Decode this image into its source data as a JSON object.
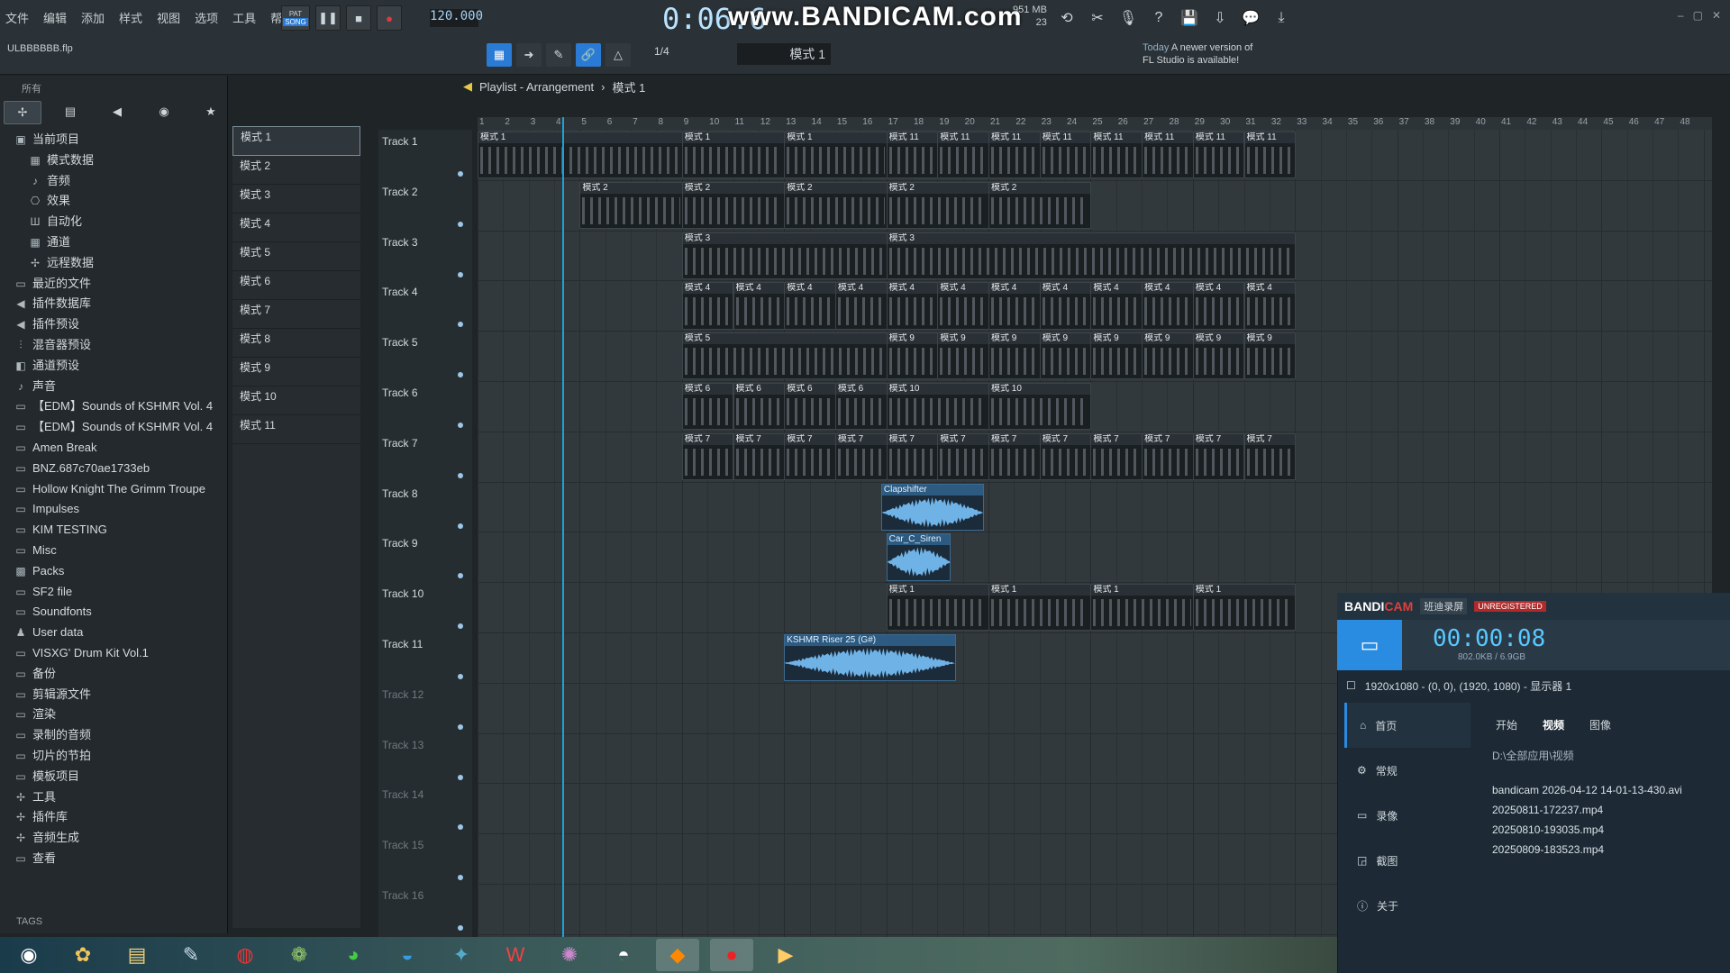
{
  "app": {
    "menus": [
      "文件",
      "编辑",
      "添加",
      "样式",
      "视图",
      "选项",
      "工具",
      "帮助"
    ],
    "tempo": "120.000",
    "time": "0:06:6",
    "time_label": "M:S:CS",
    "watermark": "www.BANDICAM.com",
    "memory": "951 MB",
    "cpu": "23",
    "project": "ULBBBBBB.flp",
    "snap": "1/4",
    "pattern_selector": "模式 1",
    "news_day": "Today",
    "news_text": "A newer version of",
    "news_text2": "FL Studio is available!",
    "mode_pat": "PAT",
    "mode_song": "SONG"
  },
  "browser": {
    "header": "所有",
    "tabs": [
      "all-icon",
      "files-icon",
      "speaker-icon",
      "globe-icon",
      "star-icon"
    ],
    "items": [
      {
        "label": "当前项目",
        "icon": "▣",
        "indent": 0
      },
      {
        "label": "模式数据",
        "icon": "▦",
        "indent": 1
      },
      {
        "label": "音频",
        "icon": "♪",
        "indent": 1
      },
      {
        "label": "效果",
        "icon": "⎔",
        "indent": 1
      },
      {
        "label": "自动化",
        "icon": "Ш",
        "indent": 1
      },
      {
        "label": "通道",
        "icon": "▦",
        "indent": 1
      },
      {
        "label": "远程数据",
        "icon": "✢",
        "indent": 1
      },
      {
        "label": "最近的文件",
        "icon": "▭",
        "indent": 0
      },
      {
        "label": "插件数据库",
        "icon": "◀",
        "indent": 0
      },
      {
        "label": "插件预设",
        "icon": "◀",
        "indent": 0
      },
      {
        "label": "混音器预设",
        "icon": "⫶",
        "indent": 0
      },
      {
        "label": "通道预设",
        "icon": "◧",
        "indent": 0
      },
      {
        "label": "声音",
        "icon": "♪",
        "indent": 0
      },
      {
        "label": "【EDM】Sounds of KSHMR Vol. 4",
        "icon": "▭",
        "indent": 0
      },
      {
        "label": "【EDM】Sounds of KSHMR Vol. 4",
        "icon": "▭",
        "indent": 0
      },
      {
        "label": "Amen Break",
        "icon": "▭",
        "indent": 0
      },
      {
        "label": "BNZ.687c70ae1733eb",
        "icon": "▭",
        "indent": 0
      },
      {
        "label": "Hollow Knight The Grimm Troupe",
        "icon": "▭",
        "indent": 0
      },
      {
        "label": "Impulses",
        "icon": "▭",
        "indent": 0
      },
      {
        "label": "KIM TESTING",
        "icon": "▭",
        "indent": 0
      },
      {
        "label": "Misc",
        "icon": "▭",
        "indent": 0
      },
      {
        "label": "Packs",
        "icon": "▩",
        "indent": 0
      },
      {
        "label": "SF2 file",
        "icon": "▭",
        "indent": 0
      },
      {
        "label": "Soundfonts",
        "icon": "▭",
        "indent": 0
      },
      {
        "label": "User data",
        "icon": "♟",
        "indent": 0
      },
      {
        "label": "VISXG' Drum Kit Vol.1",
        "icon": "▭",
        "indent": 0
      },
      {
        "label": "备份",
        "icon": "▭",
        "indent": 0
      },
      {
        "label": "剪辑源文件",
        "icon": "▭",
        "indent": 0
      },
      {
        "label": "渲染",
        "icon": "▭",
        "indent": 0
      },
      {
        "label": "录制的音频",
        "icon": "▭",
        "indent": 0
      },
      {
        "label": "切片的节拍",
        "icon": "▭",
        "indent": 0
      },
      {
        "label": "模板项目",
        "icon": "▭",
        "indent": 0
      },
      {
        "label": "工具",
        "icon": "✢",
        "indent": 0
      },
      {
        "label": "插件库",
        "icon": "✢",
        "indent": 0
      },
      {
        "label": "音频生成",
        "icon": "✢",
        "indent": 0
      },
      {
        "label": "查看",
        "icon": "▭",
        "indent": 0
      }
    ],
    "tags_label": "TAGS"
  },
  "patterns": [
    "模式 1",
    "模式 2",
    "模式 3",
    "模式 4",
    "模式 5",
    "模式 6",
    "模式 7",
    "模式 8",
    "模式 9",
    "模式 10",
    "模式 11"
  ],
  "playlist": {
    "title": "Playlist - Arrangement",
    "crumb": "模式 1",
    "bars": [
      1,
      2,
      3,
      4,
      5,
      6,
      7,
      8,
      9,
      10,
      11,
      12,
      13,
      14,
      15,
      16,
      17,
      18,
      19,
      20,
      21,
      22,
      23,
      24,
      25,
      26,
      27,
      28,
      29,
      30,
      31,
      32,
      33,
      34,
      35,
      36,
      37,
      38,
      39,
      40,
      41,
      42,
      43,
      44,
      45,
      46,
      47,
      48
    ],
    "tracks": [
      "Track 1",
      "Track 2",
      "Track 3",
      "Track 4",
      "Track 5",
      "Track 6",
      "Track 7",
      "Track 8",
      "Track 9",
      "Track 10",
      "Track 11",
      "Track 12",
      "Track 13",
      "Track 14",
      "Track 15",
      "Track 16"
    ],
    "clips": [
      {
        "track": 0,
        "start": 1,
        "len": 8,
        "label": "模式 1"
      },
      {
        "track": 0,
        "start": 9,
        "len": 4,
        "label": "模式 1"
      },
      {
        "track": 0,
        "start": 13,
        "len": 4,
        "label": "模式 1"
      },
      {
        "track": 0,
        "start": 17,
        "len": 2,
        "label": "模式 11"
      },
      {
        "track": 0,
        "start": 19,
        "len": 2,
        "label": "模式 11"
      },
      {
        "track": 0,
        "start": 21,
        "len": 2,
        "label": "模式 11"
      },
      {
        "track": 0,
        "start": 23,
        "len": 2,
        "label": "模式 11"
      },
      {
        "track": 0,
        "start": 25,
        "len": 2,
        "label": "模式 11"
      },
      {
        "track": 0,
        "start": 27,
        "len": 2,
        "label": "模式 11"
      },
      {
        "track": 0,
        "start": 29,
        "len": 2,
        "label": "模式 11"
      },
      {
        "track": 0,
        "start": 31,
        "len": 2,
        "label": "模式 11"
      },
      {
        "track": 1,
        "start": 5,
        "len": 4,
        "label": "模式 2"
      },
      {
        "track": 1,
        "start": 9,
        "len": 4,
        "label": "模式 2"
      },
      {
        "track": 1,
        "start": 13,
        "len": 4,
        "label": "模式 2"
      },
      {
        "track": 1,
        "start": 17,
        "len": 4,
        "label": "模式 2"
      },
      {
        "track": 1,
        "start": 21,
        "len": 4,
        "label": "模式 2"
      },
      {
        "track": 2,
        "start": 9,
        "len": 8,
        "label": "模式 3"
      },
      {
        "track": 2,
        "start": 17,
        "len": 16,
        "label": "模式 3"
      },
      {
        "track": 3,
        "start": 9,
        "len": 2,
        "label": "模式 4"
      },
      {
        "track": 3,
        "start": 11,
        "len": 2,
        "label": "模式 4"
      },
      {
        "track": 3,
        "start": 13,
        "len": 2,
        "label": "模式 4"
      },
      {
        "track": 3,
        "start": 15,
        "len": 2,
        "label": "模式 4"
      },
      {
        "track": 3,
        "start": 17,
        "len": 2,
        "label": "模式 4"
      },
      {
        "track": 3,
        "start": 19,
        "len": 2,
        "label": "模式 4"
      },
      {
        "track": 3,
        "start": 21,
        "len": 2,
        "label": "模式 4"
      },
      {
        "track": 3,
        "start": 23,
        "len": 2,
        "label": "模式 4"
      },
      {
        "track": 3,
        "start": 25,
        "len": 2,
        "label": "模式 4"
      },
      {
        "track": 3,
        "start": 27,
        "len": 2,
        "label": "模式 4"
      },
      {
        "track": 3,
        "start": 29,
        "len": 2,
        "label": "模式 4"
      },
      {
        "track": 3,
        "start": 31,
        "len": 2,
        "label": "模式 4"
      },
      {
        "track": 4,
        "start": 9,
        "len": 8,
        "label": "模式 5"
      },
      {
        "track": 4,
        "start": 17,
        "len": 2,
        "label": "模式 9"
      },
      {
        "track": 4,
        "start": 19,
        "len": 2,
        "label": "模式 9"
      },
      {
        "track": 4,
        "start": 21,
        "len": 2,
        "label": "模式 9"
      },
      {
        "track": 4,
        "start": 23,
        "len": 2,
        "label": "模式 9"
      },
      {
        "track": 4,
        "start": 25,
        "len": 2,
        "label": "模式 9"
      },
      {
        "track": 4,
        "start": 27,
        "len": 2,
        "label": "模式 9"
      },
      {
        "track": 4,
        "start": 29,
        "len": 2,
        "label": "模式 9"
      },
      {
        "track": 4,
        "start": 31,
        "len": 2,
        "label": "模式 9"
      },
      {
        "track": 5,
        "start": 9,
        "len": 2,
        "label": "模式 6"
      },
      {
        "track": 5,
        "start": 11,
        "len": 2,
        "label": "模式 6"
      },
      {
        "track": 5,
        "start": 13,
        "len": 2,
        "label": "模式 6"
      },
      {
        "track": 5,
        "start": 15,
        "len": 2,
        "label": "模式 6"
      },
      {
        "track": 5,
        "start": 17,
        "len": 4,
        "label": "模式 10"
      },
      {
        "track": 5,
        "start": 21,
        "len": 4,
        "label": "模式 10"
      },
      {
        "track": 6,
        "start": 9,
        "len": 2,
        "label": "模式 7"
      },
      {
        "track": 6,
        "start": 11,
        "len": 2,
        "label": "模式 7"
      },
      {
        "track": 6,
        "start": 13,
        "len": 2,
        "label": "模式 7"
      },
      {
        "track": 6,
        "start": 15,
        "len": 2,
        "label": "模式 7"
      },
      {
        "track": 6,
        "start": 17,
        "len": 2,
        "label": "模式 7"
      },
      {
        "track": 6,
        "start": 19,
        "len": 2,
        "label": "模式 7"
      },
      {
        "track": 6,
        "start": 21,
        "len": 2,
        "label": "模式 7"
      },
      {
        "track": 6,
        "start": 23,
        "len": 2,
        "label": "模式 7"
      },
      {
        "track": 6,
        "start": 25,
        "len": 2,
        "label": "模式 7"
      },
      {
        "track": 6,
        "start": 27,
        "len": 2,
        "label": "模式 7"
      },
      {
        "track": 6,
        "start": 29,
        "len": 2,
        "label": "模式 7"
      },
      {
        "track": 6,
        "start": 31,
        "len": 2,
        "label": "模式 7"
      },
      {
        "track": 7,
        "start": 16.8,
        "len": 4,
        "label": "Clapshifter",
        "audio": true
      },
      {
        "track": 8,
        "start": 17,
        "len": 2.5,
        "label": "Car_C_Siren",
        "audio": true
      },
      {
        "track": 9,
        "start": 17,
        "len": 4,
        "label": "模式 1"
      },
      {
        "track": 9,
        "start": 21,
        "len": 4,
        "label": "模式 1"
      },
      {
        "track": 9,
        "start": 25,
        "len": 4,
        "label": "模式 1"
      },
      {
        "track": 9,
        "start": 29,
        "len": 4,
        "label": "模式 1"
      },
      {
        "track": 10,
        "start": 13,
        "len": 6.7,
        "label": "KSHMR Riser 25 (G#)",
        "audio": true
      }
    ]
  },
  "bandicam": {
    "logo_a": "BANDI",
    "logo_b": "CAM",
    "cn_name": "班迪录屏",
    "unregistered": "UNREGISTERED",
    "timer": "00:00:08",
    "size": "802.0KB / 6.9GB",
    "area": "1920x1080 - (0, 0), (1920, 1080) - 显示器 1",
    "nav": [
      "首页",
      "常规",
      "录像",
      "截图",
      "关于"
    ],
    "tabs": [
      "开始",
      "视频",
      "图像"
    ],
    "path": "D:\\全部应用\\视频",
    "files": [
      "bandicam 2026-04-12 14-01-13-430.avi",
      "20250811-172237.mp4",
      "20250810-193035.mp4",
      "20250809-183523.mp4"
    ]
  },
  "taskbar": [
    "start-orb-icon",
    "pinwheel-icon",
    "explorer-icon",
    "paint-icon",
    "netease-music-icon",
    "app-icon",
    "wechat-icon",
    "edge-icon",
    "app2-icon",
    "wps-icon",
    "app3-icon",
    "qq-icon",
    "fl-studio-icon",
    "bandicam-icon",
    "media-player-icon"
  ]
}
